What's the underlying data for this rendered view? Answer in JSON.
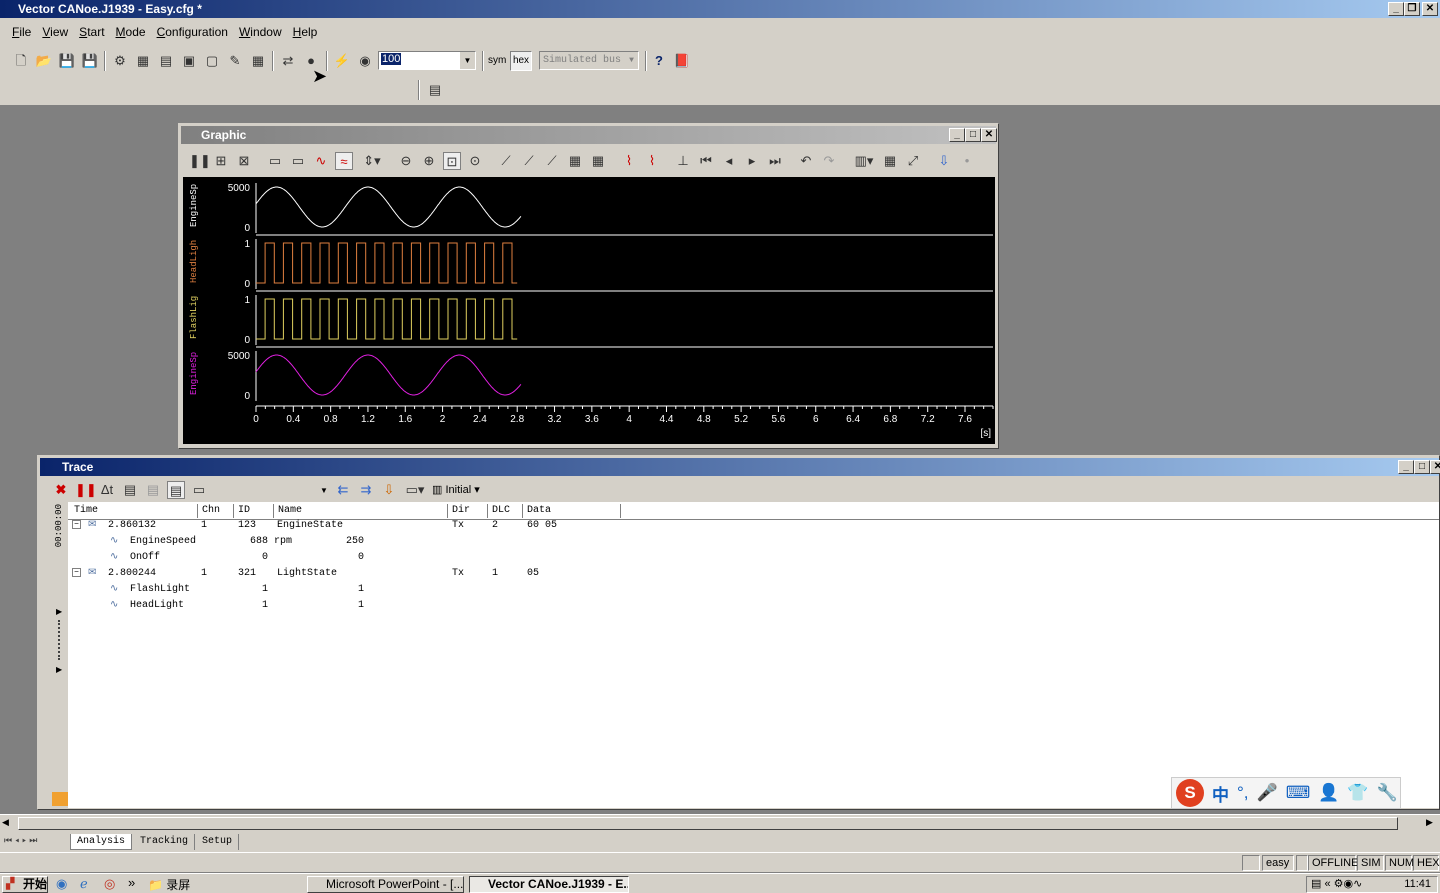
{
  "app": {
    "title": "Vector CANoe.J1939  - Easy.cfg *"
  },
  "menu": [
    "File",
    "View",
    "Start",
    "Mode",
    "Configuration",
    "Window",
    "Help"
  ],
  "toolbar": {
    "zoom_value": "100",
    "sym_label": "sym",
    "hex_label": "hex",
    "bus_mode": "Simulated bus",
    "help_icon": "?"
  },
  "graphic": {
    "title": "Graphic",
    "y_labels": [
      "EngineSp",
      "HeadLigh",
      "FlashLig",
      "EngineSp"
    ],
    "y_ticks": [
      [
        "5000",
        "0"
      ],
      [
        "1",
        "0"
      ],
      [
        "1",
        "0"
      ],
      [
        "5000",
        "0"
      ]
    ],
    "x_ticks": [
      "0",
      "0.4",
      "0.8",
      "1.2",
      "1.6",
      "2",
      "2.4",
      "2.8",
      "3.2",
      "3.6",
      "4",
      "4.4",
      "4.8",
      "5.2",
      "5.6",
      "6",
      "6.4",
      "6.8",
      "7.2",
      "7.6"
    ],
    "x_unit": "[s]",
    "colors": {
      "engine": "#ffffff",
      "headlight": "#e08040",
      "flashlight": "#e0d060",
      "engine2": "#e020e0"
    }
  },
  "chart_data": {
    "type": "line",
    "x_range": [
      0,
      7.9
    ],
    "series": [
      {
        "name": "EngineSp",
        "type": "sine",
        "min": 0,
        "max": 5000,
        "period_s": 0.98,
        "x_end": 2.84
      },
      {
        "name": "HeadLigh",
        "type": "square",
        "min": 0,
        "max": 1,
        "period_s": 0.196,
        "x_end": 2.8
      },
      {
        "name": "FlashLig",
        "type": "square",
        "min": 0,
        "max": 1,
        "period_s": 0.196,
        "x_end": 2.8
      },
      {
        "name": "EngineSp",
        "type": "sine",
        "min": 0,
        "max": 5000,
        "period_s": 0.98,
        "x_end": 2.84
      }
    ]
  },
  "trace": {
    "title": "Trace",
    "filter_label": "Initial",
    "time_side_label": "00:00:00",
    "columns": [
      "Time",
      "Chn",
      "ID",
      "Name",
      "Dir",
      "DLC",
      "Data"
    ],
    "rows": [
      {
        "time": "2.860132",
        "chn": "1",
        "id": "123",
        "name": "EngineState",
        "dir": "Tx",
        "dlc": "2",
        "data": "60 05",
        "signals": [
          {
            "name": "EngineSpeed",
            "value": "688 rpm",
            "raw": "250"
          },
          {
            "name": "OnOff",
            "value": "0",
            "raw": "0"
          }
        ]
      },
      {
        "time": "2.800244",
        "chn": "1",
        "id": "321",
        "name": "LightState",
        "dir": "Tx",
        "dlc": "1",
        "data": "05",
        "signals": [
          {
            "name": "FlashLight",
            "value": "1",
            "raw": "1"
          },
          {
            "name": "HeadLight",
            "value": "1",
            "raw": "1"
          }
        ]
      }
    ]
  },
  "tabs": [
    "Analysis",
    "Tracking",
    "Setup"
  ],
  "status": [
    "easy",
    "OFFLINE",
    "SIM",
    "NUM",
    "HEX"
  ],
  "taskbar": {
    "start": "开始",
    "folder": "录屏",
    "tasks": [
      "Microsoft PowerPoint - [...",
      "Vector CANoe.J1939  - E..."
    ],
    "clock": "11:41"
  },
  "ime": {
    "label": "中"
  }
}
